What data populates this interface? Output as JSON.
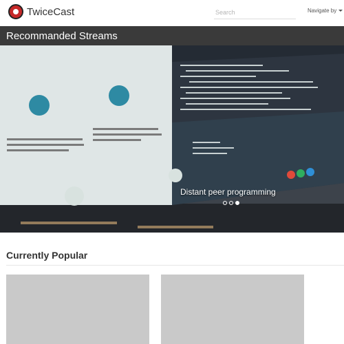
{
  "app": {
    "brand": "TwiceCast"
  },
  "search": {
    "placeholder": "Search"
  },
  "nav": {
    "navigate_label": "Navigate by"
  },
  "streams": {
    "title": "Recommanded Streams",
    "carousel": {
      "caption": "Distant peer programming",
      "slide_count": 3,
      "active_slide": 3
    }
  },
  "popular": {
    "title": "Currently Popular",
    "cards": [
      {},
      {}
    ]
  }
}
